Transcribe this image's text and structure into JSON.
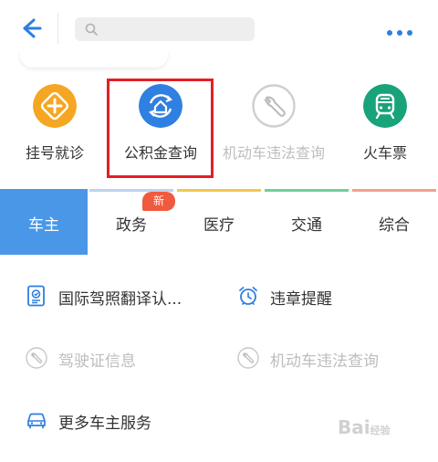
{
  "header": {
    "search_placeholder": "",
    "icons": {
      "back": "back-arrow-icon",
      "search": "search-icon",
      "more": "more-dots-icon"
    }
  },
  "services": [
    {
      "label": "挂号就诊",
      "icon": "hospital-cross-icon",
      "color": "#f5a623",
      "enabled": true
    },
    {
      "label": "公积金查询",
      "icon": "housing-fund-icon",
      "color": "#2f80e0",
      "enabled": true,
      "highlighted": true
    },
    {
      "label": "机动车违法查询",
      "icon": "wrench-icon",
      "color": "#cfcfcf",
      "enabled": false
    },
    {
      "label": "火车票",
      "icon": "train-icon",
      "color": "#19a37a",
      "enabled": true
    }
  ],
  "tabs": [
    {
      "label": "车主",
      "active": true,
      "line_color": "#4a97e8"
    },
    {
      "label": "政务",
      "active": false,
      "line_color": "#bcd3f0"
    },
    {
      "label": "医疗",
      "active": false,
      "line_color": "#f2c94c"
    },
    {
      "label": "交通",
      "active": false,
      "line_color": "#6fcf97"
    },
    {
      "label": "综合",
      "active": false,
      "line_color": "#f2a08b"
    }
  ],
  "badge": {
    "text": "新"
  },
  "owner_services": [
    {
      "label": "国际驾照翻译认...",
      "icon": "license-doc-icon",
      "enabled": true
    },
    {
      "label": "违章提醒",
      "icon": "alarm-clock-icon",
      "enabled": true
    },
    {
      "label": "驾驶证信息",
      "icon": "wrench-icon",
      "enabled": false
    },
    {
      "label": "机动车违法查询",
      "icon": "wrench-icon",
      "enabled": false
    },
    {
      "label": "更多车主服务",
      "icon": "car-icon",
      "enabled": true
    }
  ],
  "watermark": {
    "text": "Bai",
    "suffix": "经验"
  },
  "colors": {
    "accent": "#2e7fe0",
    "highlight": "#e41e26",
    "disabled": "#bdbdbd"
  }
}
